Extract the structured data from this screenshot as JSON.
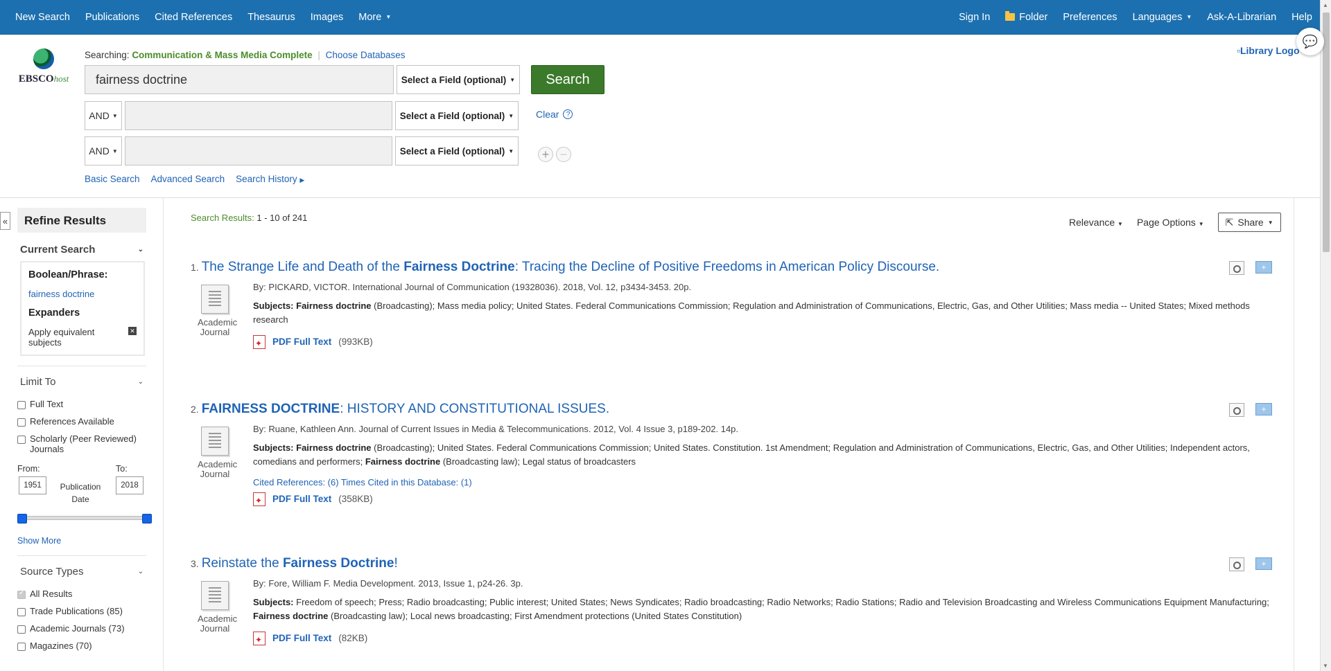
{
  "topnav": {
    "left": [
      "New Search",
      "Publications",
      "Cited References",
      "Thesaurus",
      "Images",
      "More"
    ],
    "right": [
      "Sign In",
      "Folder",
      "Preferences",
      "Languages",
      "Ask-A-Librarian",
      "Help"
    ]
  },
  "logo": {
    "brand_main": "EBSCO",
    "brand_suffix": "host"
  },
  "searching": {
    "label": "Searching:",
    "database": "Communication & Mass Media Complete",
    "choose": "Choose Databases"
  },
  "search": {
    "row1": {
      "term": "fairness doctrine",
      "field": "Select a Field (optional)"
    },
    "row2": {
      "bool": "AND",
      "term": "",
      "field": "Select a Field (optional)"
    },
    "row3": {
      "bool": "AND",
      "term": "",
      "field": "Select a Field (optional)"
    },
    "button": "Search",
    "clear": "Clear",
    "help": "?"
  },
  "sublinks": [
    "Basic Search",
    "Advanced Search",
    "Search History"
  ],
  "library_logo": "Library Logo",
  "sidebar": {
    "title": "Refine Results",
    "current_search": "Current Search",
    "boolean_label": "Boolean/Phrase:",
    "boolean_value": "fairness doctrine",
    "expanders_label": "Expanders",
    "expander_value": "Apply equivalent subjects",
    "limit_to": "Limit To",
    "limits": [
      "Full Text",
      "References Available",
      "Scholarly (Peer Reviewed) Journals"
    ],
    "from_label": "From:",
    "to_label": "To:",
    "from_year": "1951",
    "to_year": "2018",
    "pub_date": "Publication Date",
    "show_more": "Show More",
    "source_types": "Source Types",
    "sources": [
      "All Results",
      "Trade Publications (85)",
      "Academic Journals (73)",
      "Magazines (70)"
    ]
  },
  "results_header": {
    "label": "Search Results:",
    "range": "1 - 10 of 241",
    "sort": "Relevance",
    "page_options": "Page Options",
    "share": "Share"
  },
  "results": [
    {
      "num": "1.",
      "title_pre": "The Strange Life and Death of the ",
      "title_bold": "Fairness Doctrine",
      "title_post": ": Tracing the Decline of Positive Freedoms in American Policy Discourse.",
      "type": "Academic Journal",
      "byline": "By: PICKARD, VICTOR. International Journal of Communication (19328036). 2018, Vol. 12, p3434-3453. 20p.",
      "subjects_label": "Subjects:",
      "subjects_bold1": "Fairness doctrine",
      "subjects_rest1": " (Broadcasting); Mass media policy; United States. Federal Communications Commission; Regulation and Administration of Communications, Electric, Gas, and Other Utilities; Mass media -- United States; Mixed methods research",
      "subjects_bold2": "",
      "subjects_rest2": "",
      "cited": "",
      "pdf_label": "PDF Full Text",
      "pdf_size": "(993KB)"
    },
    {
      "num": "2.",
      "title_pre": "",
      "title_bold": "FAIRNESS DOCTRINE",
      "title_post": ": HISTORY AND CONSTITUTIONAL ISSUES.",
      "type": "Academic Journal",
      "byline": "By: Ruane, Kathleen Ann. Journal of Current Issues in Media & Telecommunications. 2012, Vol. 4 Issue 3, p189-202. 14p.",
      "subjects_label": "Subjects:",
      "subjects_bold1": "Fairness doctrine",
      "subjects_rest1": " (Broadcasting); United States. Federal Communications Commission; United States. Constitution. 1st Amendment; Regulation and Administration of Communications, Electric, Gas, and Other Utilities; Independent actors, comedians and performers; ",
      "subjects_bold2": "Fairness doctrine",
      "subjects_rest2": " (Broadcasting law); Legal status of broadcasters",
      "cited": "Cited References: (6) Times Cited in this Database: (1)",
      "pdf_label": "PDF Full Text",
      "pdf_size": "(358KB)"
    },
    {
      "num": "3.",
      "title_pre": "Reinstate the ",
      "title_bold": "Fairness Doctrine",
      "title_post": "!",
      "type": "Academic Journal",
      "byline": "By: Fore, William F. Media Development. 2013, Issue 1, p24-26. 3p.",
      "subjects_label": "Subjects:",
      "subjects_bold1": "",
      "subjects_rest1": "Freedom of speech; Press; Radio broadcasting; Public interest; United States; News Syndicates; Radio broadcasting; Radio Networks; Radio Stations; Radio and Television Broadcasting and Wireless Communications Equipment Manufacturing; ",
      "subjects_bold2": "Fairness doctrine",
      "subjects_rest2": " (Broadcasting law); Local news broadcasting; First Amendment protections (United States Constitution)",
      "cited": "",
      "pdf_label": "PDF Full Text",
      "pdf_size": "(82KB)"
    }
  ]
}
